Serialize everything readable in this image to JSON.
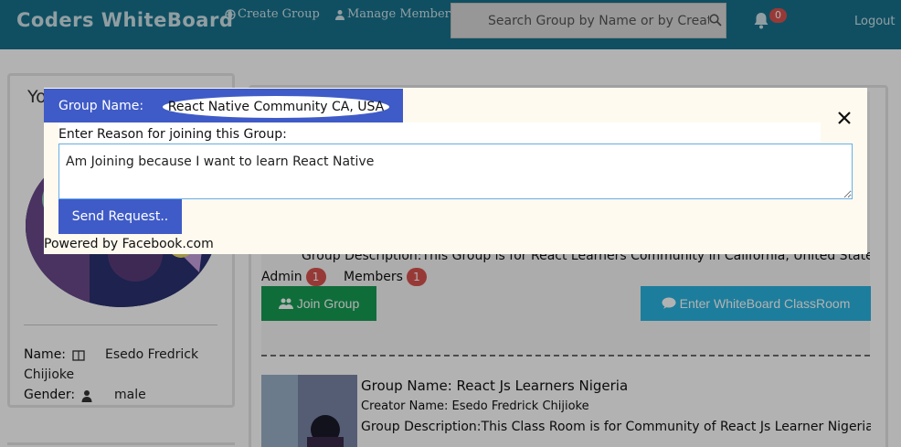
{
  "navbar": {
    "brand": "Coders WhiteBoard",
    "create_group": "Create Group",
    "manage_members": "Manage Members",
    "search_placeholder": "Search Group by Name or by Creator",
    "notification_count": "0",
    "logout": "Logout"
  },
  "profile": {
    "title": "Yo",
    "name_label": "Name:",
    "name_value": "Esedo Fredrick",
    "name_value_2": "Chijioke",
    "gender_label": "Gender:",
    "gender_value": "male"
  },
  "group1": {
    "description_label": "Group Description:",
    "description_value": "This Group is for React Learners Community in California, United States",
    "admin_label": "Admin",
    "admin_count": "1",
    "members_label": "Members",
    "members_count": "1",
    "join_label": "Join Group",
    "enter_label": "Enter WhiteBoard ClassRoom"
  },
  "group2": {
    "name_label": "Group Name:",
    "name_value": "React Js Learners Nigeria",
    "creator_label": "Creator Name:",
    "creator_value": "Esedo Fredrick Chijioke",
    "description_label": "Group Description:",
    "description_value": "This Class Room is for Community of React Js Learner Nigeria"
  },
  "modal": {
    "group_name_label": "Group Name:",
    "group_name_value": "React Native Community CA, USA",
    "reason_label": "Enter Reason for joining this Group:",
    "reason_value": "Am Joining because I want to learn React Native",
    "send_label": "Send Request..",
    "powered_by": "Powered by Facebook.com"
  },
  "icons": {
    "create_group": "globe-icon",
    "manage_members": "user-icon",
    "search": "search-icon",
    "notifications": "bell-icon",
    "name": "id-card-icon",
    "gender": "user-icon",
    "join": "users-icon",
    "enter": "comment-icon",
    "close": "close-icon"
  },
  "colors": {
    "navbar": "#18718d",
    "modal_header": "#3f5bc7",
    "join_button": "#169c54",
    "enter_button": "#2ab3e0",
    "badge": "#d9534f"
  }
}
